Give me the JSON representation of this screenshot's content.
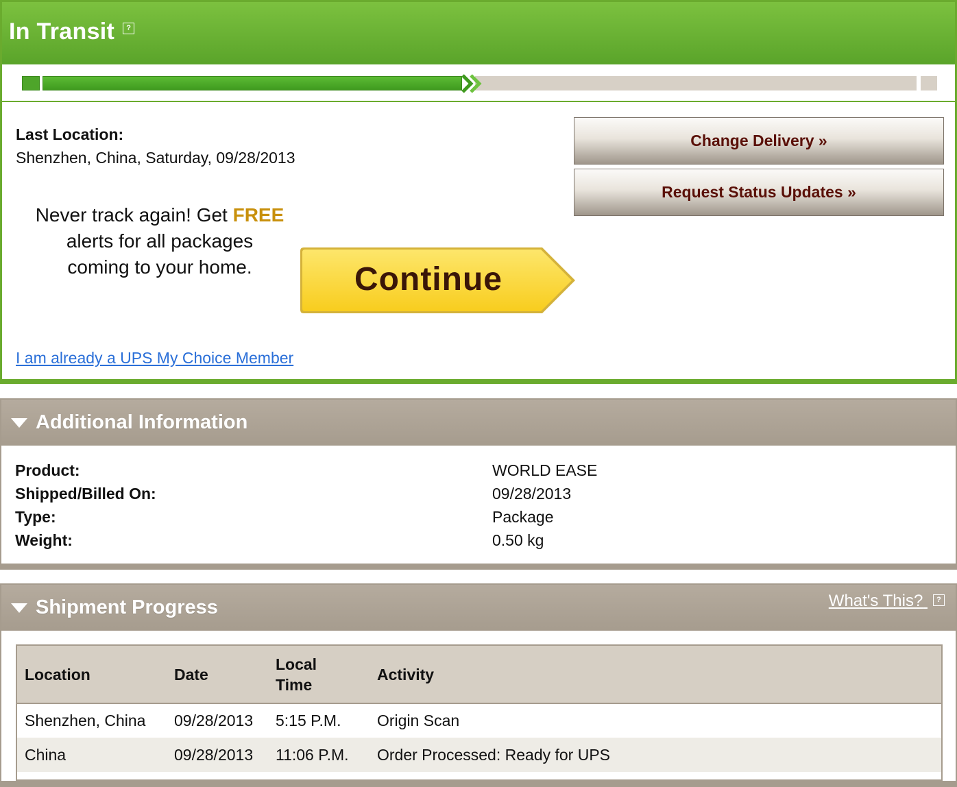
{
  "status": {
    "title": "In Transit",
    "help_icon": "?",
    "progress_fraction": 0.49,
    "last_location_label": "Last Location:",
    "last_location_value": "Shenzhen, China, Saturday, 09/28/2013",
    "promo_prefix": "Never track again! Get ",
    "promo_free": "FREE",
    "promo_suffix": "alerts for all packages coming to your home.",
    "continue_label": "Continue",
    "member_link": "I am already a UPS My Choice Member",
    "change_delivery_label": "Change Delivery »",
    "request_updates_label": "Request Status Updates »"
  },
  "additional_info": {
    "title": "Additional Information",
    "rows": [
      {
        "label": "Product:",
        "value": "WORLD EASE"
      },
      {
        "label": "Shipped/Billed On:",
        "value": "09/28/2013"
      },
      {
        "label": "Type:",
        "value": "Package"
      },
      {
        "label": "Weight:",
        "value": "0.50 kg"
      }
    ]
  },
  "shipment_progress": {
    "title": "Shipment Progress",
    "whats_this": "What's This?",
    "help_icon": "?",
    "columns": [
      "Location",
      "Date",
      "Local Time",
      "Activity"
    ],
    "rows": [
      {
        "location": "Shenzhen, China",
        "date": "09/28/2013",
        "time": "5:15 P.M.",
        "activity": "Origin Scan"
      },
      {
        "location": "China",
        "date": "09/28/2013",
        "time": "11:06 P.M.",
        "activity": "Order Processed: Ready for UPS"
      }
    ]
  },
  "colors": {
    "green": "#6aab2e",
    "taupe": "#a69c8e",
    "free_text": "#c8900c",
    "continue_yellow": "#fcd836",
    "button_text": "#5a1008",
    "link": "#2a6fd8"
  }
}
